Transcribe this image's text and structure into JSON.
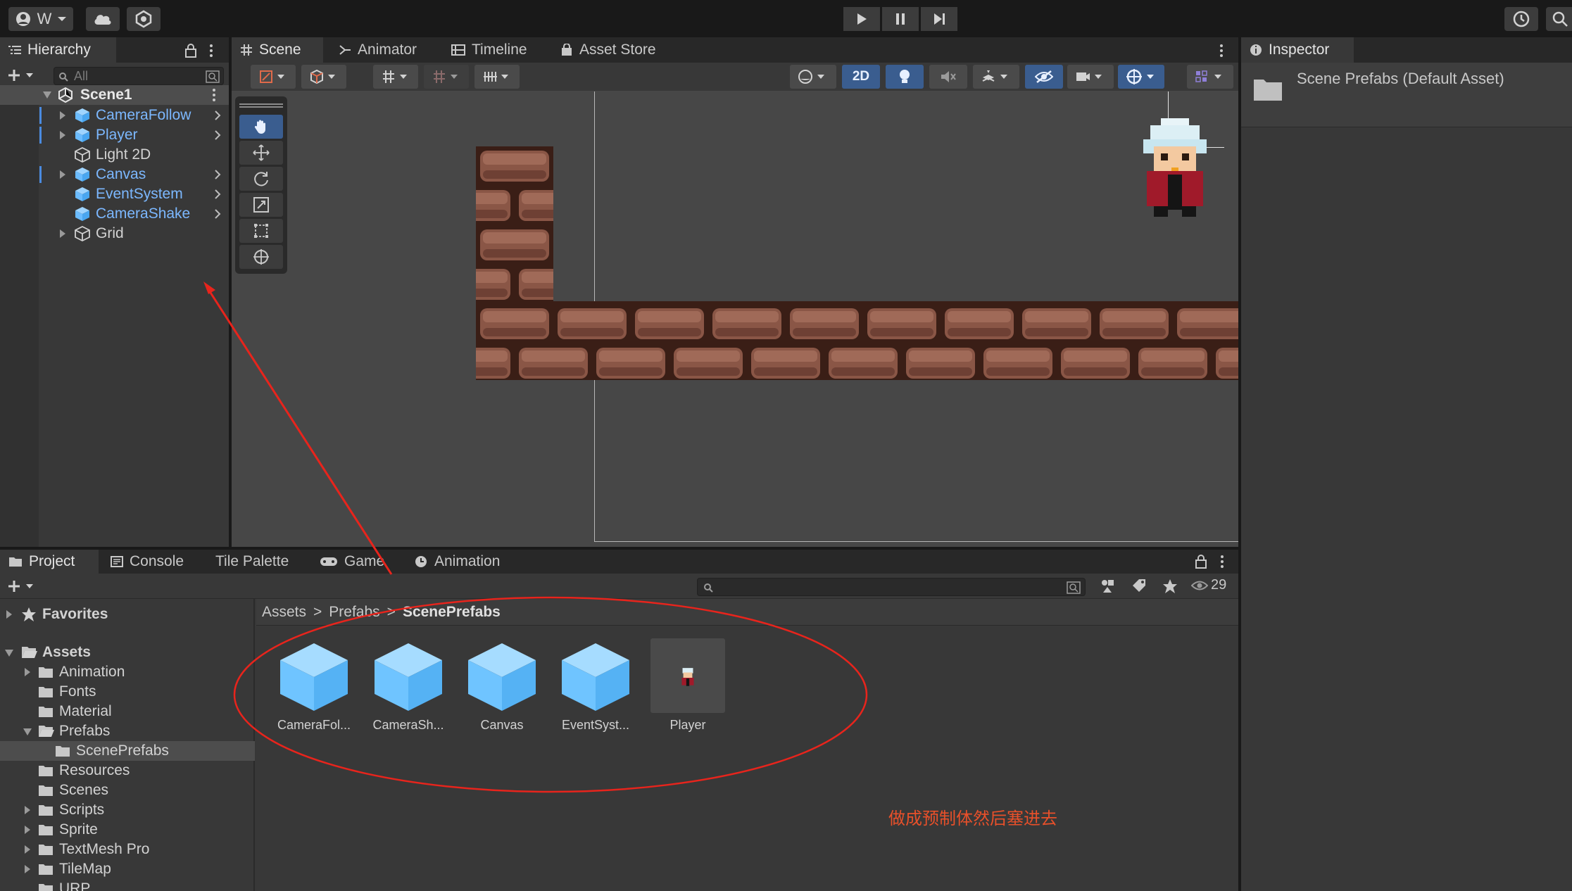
{
  "toolbar": {
    "account_label": "W",
    "icons": [
      "account-icon",
      "cloud-icon",
      "collab-icon",
      "play-icon",
      "pause-icon",
      "step-icon",
      "history-icon",
      "search-icon"
    ]
  },
  "hierarchy": {
    "title": "Hierarchy",
    "search_placeholder": "All",
    "scene_name": "Scene1",
    "items": [
      {
        "name": "CameraFollow",
        "type": "prefab",
        "expandable": true
      },
      {
        "name": "Player",
        "type": "prefab",
        "expandable": true
      },
      {
        "name": "Light 2D",
        "type": "plain",
        "expandable": false
      },
      {
        "name": "Canvas",
        "type": "prefab",
        "expandable": true
      },
      {
        "name": "EventSystem",
        "type": "prefab",
        "expandable": false
      },
      {
        "name": "CameraShake",
        "type": "prefab",
        "expandable": false
      },
      {
        "name": "Grid",
        "type": "plain",
        "expandable": true
      }
    ]
  },
  "scene_tabs": {
    "scene": "Scene",
    "animator": "Animator",
    "timeline": "Timeline",
    "asset_store": "Asset Store"
  },
  "scene_toolbar": {
    "mode_2d": "2D"
  },
  "inspector": {
    "title": "Inspector",
    "asset_name": "Scene Prefabs (Default Asset)"
  },
  "bottom_tabs": {
    "project": "Project",
    "console": "Console",
    "tile_palette": "Tile Palette",
    "game": "Game",
    "animation": "Animation"
  },
  "project": {
    "favorites": "Favorites",
    "assets_root": "Assets",
    "visible_count": "29",
    "breadcrumb": [
      "Assets",
      "Prefabs",
      "ScenePrefabs"
    ],
    "folders": [
      {
        "name": "Animation",
        "depth": 1,
        "expandable": true
      },
      {
        "name": "Fonts",
        "depth": 1,
        "expandable": false
      },
      {
        "name": "Material",
        "depth": 1,
        "expandable": false
      },
      {
        "name": "Prefabs",
        "depth": 1,
        "expandable": true,
        "expanded": true
      },
      {
        "name": "ScenePrefabs",
        "depth": 2,
        "expandable": false,
        "selected": true
      },
      {
        "name": "Resources",
        "depth": 1,
        "expandable": false
      },
      {
        "name": "Scenes",
        "depth": 1,
        "expandable": false
      },
      {
        "name": "Scripts",
        "depth": 1,
        "expandable": true
      },
      {
        "name": "Sprite",
        "depth": 1,
        "expandable": true
      },
      {
        "name": "TextMesh Pro",
        "depth": 1,
        "expandable": true
      },
      {
        "name": "TileMap",
        "depth": 1,
        "expandable": true
      },
      {
        "name": "URP",
        "depth": 1,
        "expandable": false
      }
    ],
    "assets": [
      {
        "label": "CameraFol...",
        "kind": "prefab"
      },
      {
        "label": "CameraSh...",
        "kind": "prefab"
      },
      {
        "label": "Canvas",
        "kind": "prefab"
      },
      {
        "label": "EventSyst...",
        "kind": "prefab"
      },
      {
        "label": "Player",
        "kind": "sprite-prefab"
      }
    ]
  },
  "annotation": {
    "note": "做成预制体然后塞进去",
    "color": "#e8502a"
  },
  "colors": {
    "prefab_blue": "#7cb8ff",
    "annotation_red": "#e8241c",
    "selection": "#4d4d4d",
    "brick": "#7a4a3c"
  }
}
